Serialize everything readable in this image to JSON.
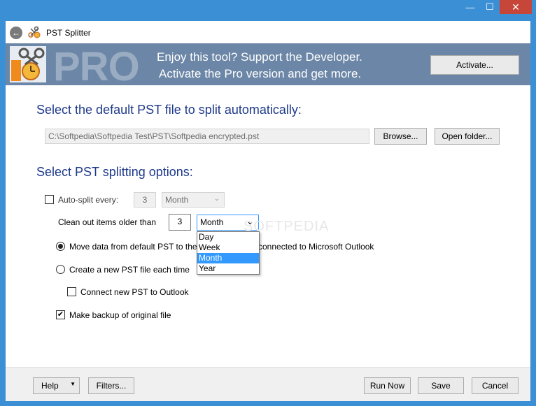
{
  "window": {
    "title": "PST Splitter",
    "controls": {
      "minimize": "—",
      "maximize": "☐",
      "close": "✕"
    }
  },
  "banner": {
    "logo_text": "PRO",
    "line1": "Enjoy this tool? Support the Developer.",
    "line2": "Activate the Pro version and get more.",
    "activate_label": "Activate..."
  },
  "file_section": {
    "heading": "Select the default PST file to split automatically:",
    "path": "C:\\Softpedia\\Softpedia Test\\PST\\Softpedia encrypted.pst",
    "browse_label": "Browse...",
    "open_folder_label": "Open folder..."
  },
  "options": {
    "heading": "Select PST splitting options:",
    "auto_split_label": "Auto-split every:",
    "auto_split_checked": false,
    "auto_split_value": "3",
    "auto_split_unit": "Month",
    "clean_label": "Clean out items older than",
    "clean_value": "3",
    "clean_unit": "Month",
    "unit_options": [
      "Day",
      "Week",
      "Month",
      "Year"
    ],
    "move_label_left": "Move data from default PST to the",
    "move_label_right": "connected to Microsoft Outlook",
    "create_label": "Create a new PST file each time",
    "connect_label": "Connect new PST to Outlook",
    "backup_label": "Make backup of original file",
    "backup_checked": true
  },
  "watermark": "SOFTPEDIA",
  "footer": {
    "help_label": "Help",
    "filters_label": "Filters...",
    "run_label": "Run Now",
    "save_label": "Save",
    "cancel_label": "Cancel"
  },
  "colors": {
    "frame": "#3b8fd4",
    "banner": "#6b86a6",
    "heading": "#1e3a8a",
    "selection": "#3399ff"
  }
}
